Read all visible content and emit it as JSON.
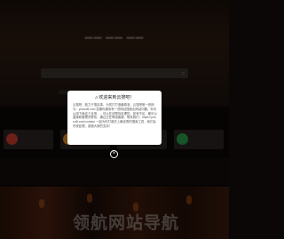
{
  "modal": {
    "title": "欢迎来到云搜吧！",
    "body": "云搜吧，致力于搜百事，为您打打造最精准，云搜吧唯一官网为：yunsuB.com 如果你遇到有一些网站搜索出网站问题，你可以用下面这个反馈，，可以在线帮你处理的，如有不足，都可以直接和管理员联系，通过正在联络客服，联系我们：https://yunsuB.com/contact 一起为你打造史上最优秀的搜索工具，我们会尽快处理，感谢大家的支持！"
  },
  "watermark": {
    "text": "领航网站导航"
  },
  "icons": {
    "bell": "bell-icon",
    "search": "search-icon",
    "close": "close-icon"
  },
  "colors": {
    "modal_background": "#ffffff",
    "overlay": "rgba(0,0,0,0.45)",
    "lamp": "#b8591c"
  }
}
